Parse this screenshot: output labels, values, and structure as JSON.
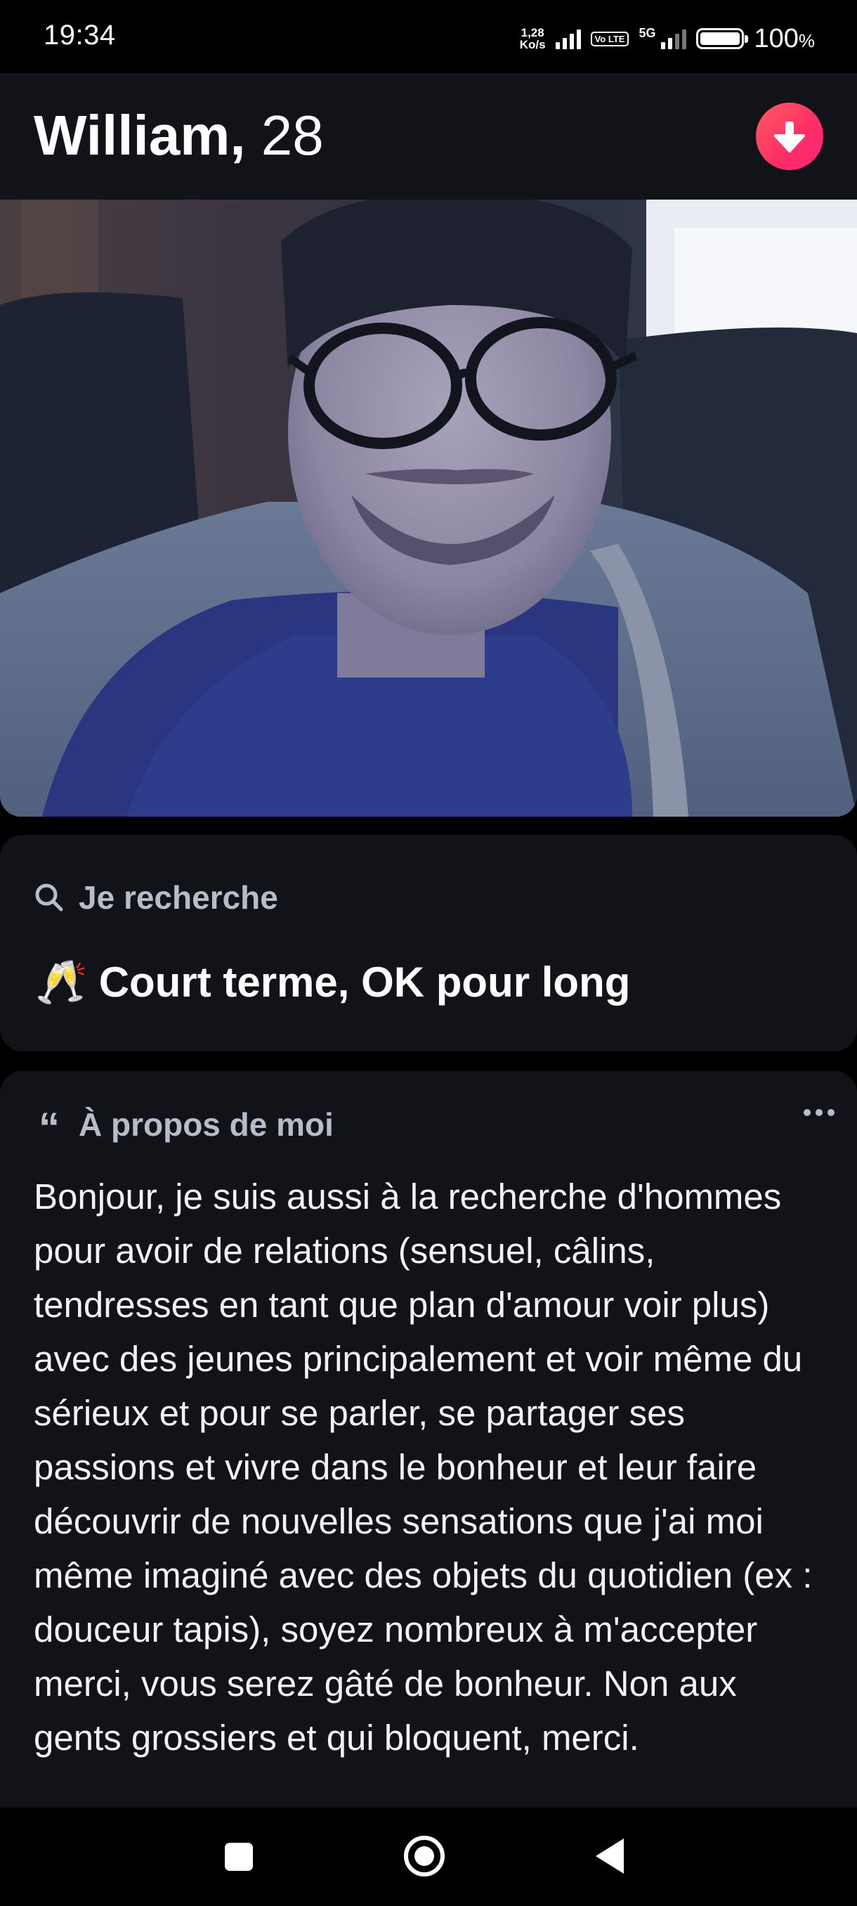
{
  "status_bar": {
    "time": "19:34",
    "net_speed_value": "1,28",
    "net_speed_unit": "Ko/s",
    "volte_label": "Vo LTE",
    "network_type": "5G",
    "battery_percent": "100",
    "battery_unit": "%"
  },
  "profile": {
    "name": "William,",
    "age": "28",
    "accent_color": "#fe3c72"
  },
  "looking_for": {
    "header": "Je recherche",
    "emoji": "🥂",
    "value": "Court terme, OK pour long"
  },
  "about": {
    "header": "À propos de moi",
    "quote_glyph": "“",
    "text": "Bonjour, je suis aussi à la recherche d'hommes pour avoir de relations (sensuel, câlins, tendresses en tant que plan d'amour voir plus) avec des jeunes principalement et voir même du sérieux et pour se parler, se partager ses passions et vivre dans le bonheur et leur faire découvrir de nouvelles sensations que j'ai moi même imaginé avec des objets du quotidien (ex : douceur tapis), soyez nombreux à m'accepter merci, vous serez gâté de bonheur. Non aux gents grossiers et qui bloquent, merci."
  },
  "icons": {
    "collapse": "arrow-down-icon",
    "search": "search-icon",
    "quote": "quote-icon",
    "more": "more-icon",
    "nav_recent": "square-icon",
    "nav_home": "circle-icon",
    "nav_back": "triangle-back-icon"
  }
}
